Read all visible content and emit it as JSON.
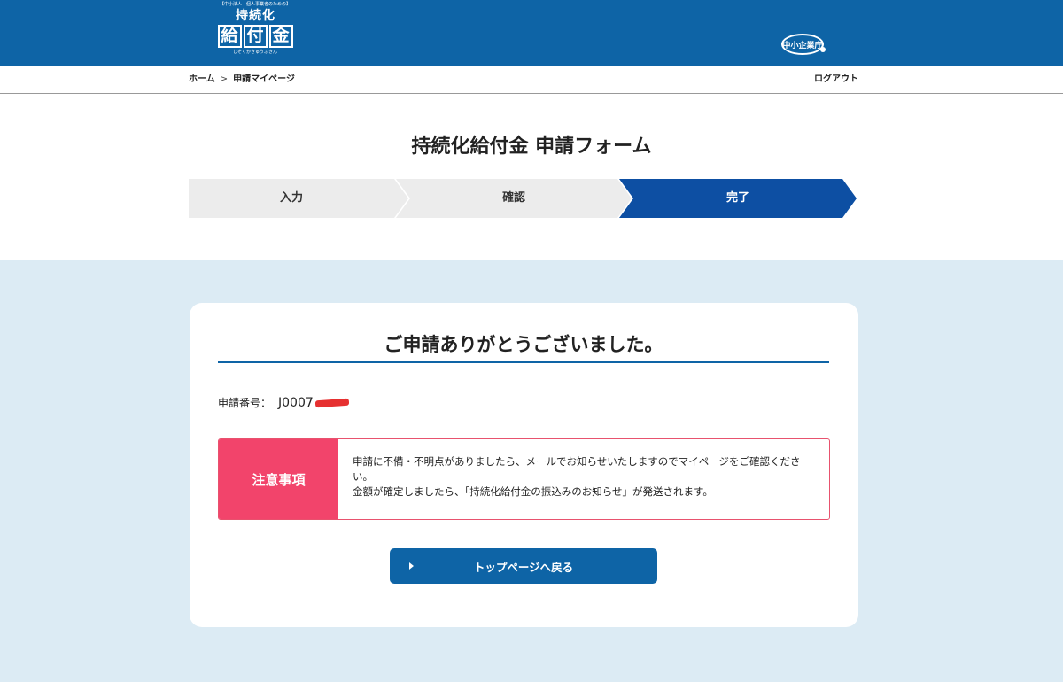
{
  "header": {
    "logo_caption": "【中小法人・個人事業者のための】",
    "logo_line1": [
      "持",
      "続",
      "化"
    ],
    "logo_line2": [
      "給",
      "付",
      "金"
    ],
    "logo_reading": "じぞくかきゅうふきん",
    "agency_logo": "中小企業庁",
    "colors": {
      "brand": "#0e64a6"
    }
  },
  "breadcrumb": {
    "home": "ホーム",
    "separator": ">",
    "current": "申請マイページ",
    "logout": "ログアウト"
  },
  "page_title": "持続化給付金 申請フォーム",
  "stepper": {
    "steps": [
      "入力",
      "確認",
      "完了"
    ],
    "active_index": 2,
    "colors": {
      "inactive": "#ececec",
      "active": "#0d4fa3"
    }
  },
  "completion": {
    "thanks": "ご申請ありがとうございました。",
    "app_number_label": "申請番号：",
    "app_number_value": "J0007",
    "notice": {
      "title": "注意事項",
      "line1": "申請に不備・不明点がありましたら、メールでお知らせいたしますのでマイページをご確認ください。",
      "line2": "金額が確定しましたら、「持続化給付金の振込みのお知らせ」が発送されます。",
      "color": "#f2446b"
    },
    "back_button": "トップページへ戻る"
  }
}
